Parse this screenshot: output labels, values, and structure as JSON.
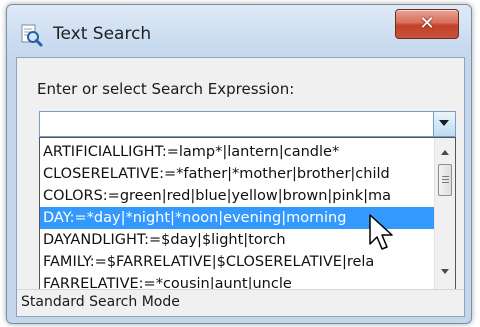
{
  "window": {
    "title": "Text Search",
    "title_icon": "search-document-icon",
    "close_icon": "close-icon",
    "close_glyph": "✕"
  },
  "search": {
    "prompt": "Enter or select Search Expression:",
    "value": "",
    "dropdown_icon": "chevron-down-icon"
  },
  "dropdown": {
    "items": [
      {
        "label": "ARTIFICIALLIGHT:=lamp*|lantern|candle*",
        "selected": false
      },
      {
        "label": "CLOSERELATIVE:=*father|*mother|brother|child",
        "selected": false
      },
      {
        "label": "COLORS:=green|red|blue|yellow|brown|pink|ma",
        "selected": false
      },
      {
        "label": "DAY:=*day|*night|*noon|evening|morning",
        "selected": true
      },
      {
        "label": "DAYANDLIGHT:=$day|$light|torch",
        "selected": false
      },
      {
        "label": "FAMILY:=$FARRELATIVE|$CLOSERELATIVE|rela",
        "selected": false
      },
      {
        "label": "FARRELATIVE:=*cousin|aunt|uncle",
        "selected": false
      }
    ],
    "scroll_position": 0.08
  },
  "status": {
    "text": "Standard Search Mode"
  },
  "colors": {
    "selection": "#3399ff",
    "close_button": "#c9523b",
    "title_bar": "#c9dbef"
  }
}
